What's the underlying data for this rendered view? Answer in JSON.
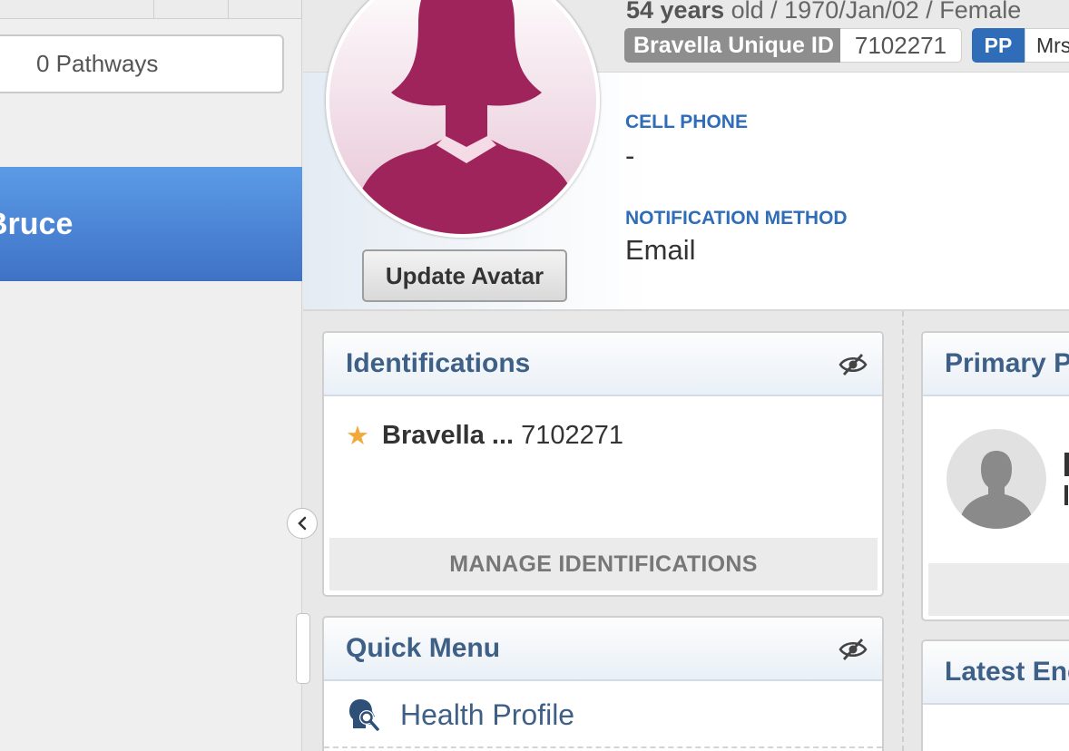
{
  "left_pane": {
    "pathways_label": "0 Pathways",
    "selected_item_label": "Bruce"
  },
  "patient": {
    "age_value": "54 years",
    "age_rest": " old / 1970/Jan/02 / Female",
    "id_label": "Bravella Unique ID",
    "id_value": "7102271",
    "pp_badge": "PP",
    "pp_value": "Mrs",
    "update_avatar_label": "Update Avatar",
    "cell_phone_label": "CELL PHONE",
    "cell_phone_value": "-",
    "notification_label": "NOTIFICATION METHOD",
    "notification_value": "Email"
  },
  "identifications": {
    "title": "Identifications",
    "items": [
      {
        "name": "Bravella ...",
        "value": "7102271",
        "primary": true
      }
    ],
    "manage_label": "MANAGE IDENTIFICATIONS"
  },
  "quick_menu": {
    "title": "Quick Menu",
    "items": [
      {
        "label": "Health Profile",
        "icon": "health-profile-icon"
      }
    ]
  },
  "primary_provider": {
    "title": "Primary Pr"
  },
  "latest_encounter": {
    "title": "Latest Enc"
  },
  "colors": {
    "accent_blue": "#2f6db8",
    "selected_blue": "#4a86d8",
    "avatar_magenta": "#a0245c",
    "star_orange": "#f2a93b",
    "card_title": "#3e5f86"
  }
}
